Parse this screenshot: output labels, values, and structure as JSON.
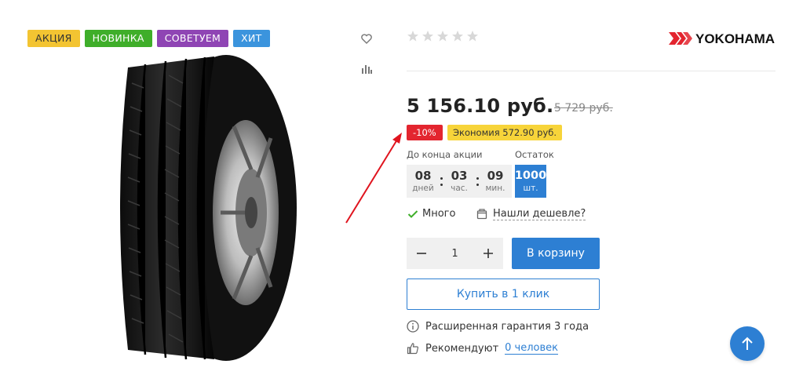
{
  "badges": {
    "akcia": "АКЦИЯ",
    "novinka": "НОВИНКА",
    "sovetuem": "СОВЕТУЕМ",
    "hit": "ХИТ"
  },
  "brand": {
    "name": "YOKOHAMA"
  },
  "rating": {
    "stars_filled": 0,
    "stars_total": 5
  },
  "price": {
    "current": "5 156.10 руб.",
    "old": "5 729 руб.",
    "discount": "-10%",
    "economy": "Экономия 572.90 руб."
  },
  "timer": {
    "label": "До конца акции",
    "days": {
      "value": "08",
      "unit": "дней"
    },
    "hours": {
      "value": "03",
      "unit": "час."
    },
    "minutes": {
      "value": "09",
      "unit": "мин."
    }
  },
  "stock": {
    "label": "Остаток",
    "value": "1000",
    "unit": "шт."
  },
  "availability": {
    "label": "Много"
  },
  "cheaper": {
    "label": "Нашли дешевле?"
  },
  "quantity": {
    "value": "1"
  },
  "buttons": {
    "cart": "В корзину",
    "one_click": "Купить в 1 клик"
  },
  "info": {
    "warranty": "Расширенная гарантия 3 года",
    "recommend_prefix": "Рекомендуют",
    "recommend_link": "0 человек"
  },
  "colors": {
    "primary": "#2d7fd3",
    "discount": "#e3252f",
    "economy": "#f7d43a",
    "badge_akcia": "#f3c432",
    "badge_novinka": "#3fae2a",
    "badge_sovetuem": "#8f45b4",
    "badge_hit": "#3b94dd",
    "annotation_arrow": "#e0141e"
  },
  "icons": [
    "heart-icon",
    "compare-icon",
    "star-icon",
    "check-icon",
    "price-tag-icon",
    "minus-icon",
    "plus-icon",
    "info-icon",
    "thumbs-up-icon",
    "arrow-up-icon"
  ]
}
